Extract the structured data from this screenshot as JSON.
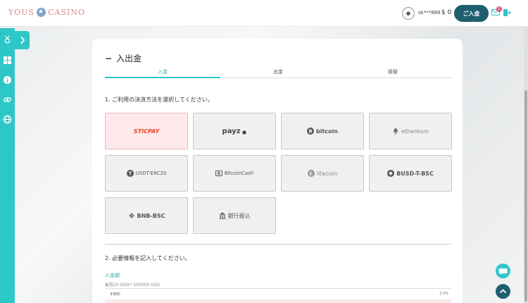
{
  "header": {
    "logo_left": "YOUS",
    "logo_right": "CASINO",
    "avatar_text": "●",
    "username": "sk***888",
    "balance": "$ 0",
    "deposit_label": "ご入金",
    "mail_badge": "2"
  },
  "panel": {
    "title": "入出金",
    "tabs": [
      {
        "label": "入金",
        "active": true
      },
      {
        "label": "出金",
        "active": false
      },
      {
        "label": "振替",
        "active": false
      }
    ],
    "step1": "1. ご利用の決済方法を選択してください。",
    "methods": [
      {
        "label": "STICPAY",
        "selected": true
      },
      {
        "label": "payz"
      },
      {
        "label": "bitcoin"
      },
      {
        "label": "ethereum"
      },
      {
        "label": "USDT-ERC20"
      },
      {
        "label": "BitcoinCash"
      },
      {
        "label": "litecoin"
      },
      {
        "label": "BUSD-T-BSC"
      },
      {
        "label": "BNB-BSC"
      },
      {
        "label": "銀行振込"
      }
    ],
    "step2": "2. 必要情報を記入してください。",
    "amount_label": "入金額",
    "amount_hint": "最低20 USD〜100000 USD",
    "fee_label": "手数料",
    "fee_value": "2.5%"
  },
  "colors": {
    "accent": "#2ec7c7",
    "primary": "#1e5f6f",
    "selected_bg": "#fde9ea",
    "sticpay_red": "#e8472a"
  }
}
